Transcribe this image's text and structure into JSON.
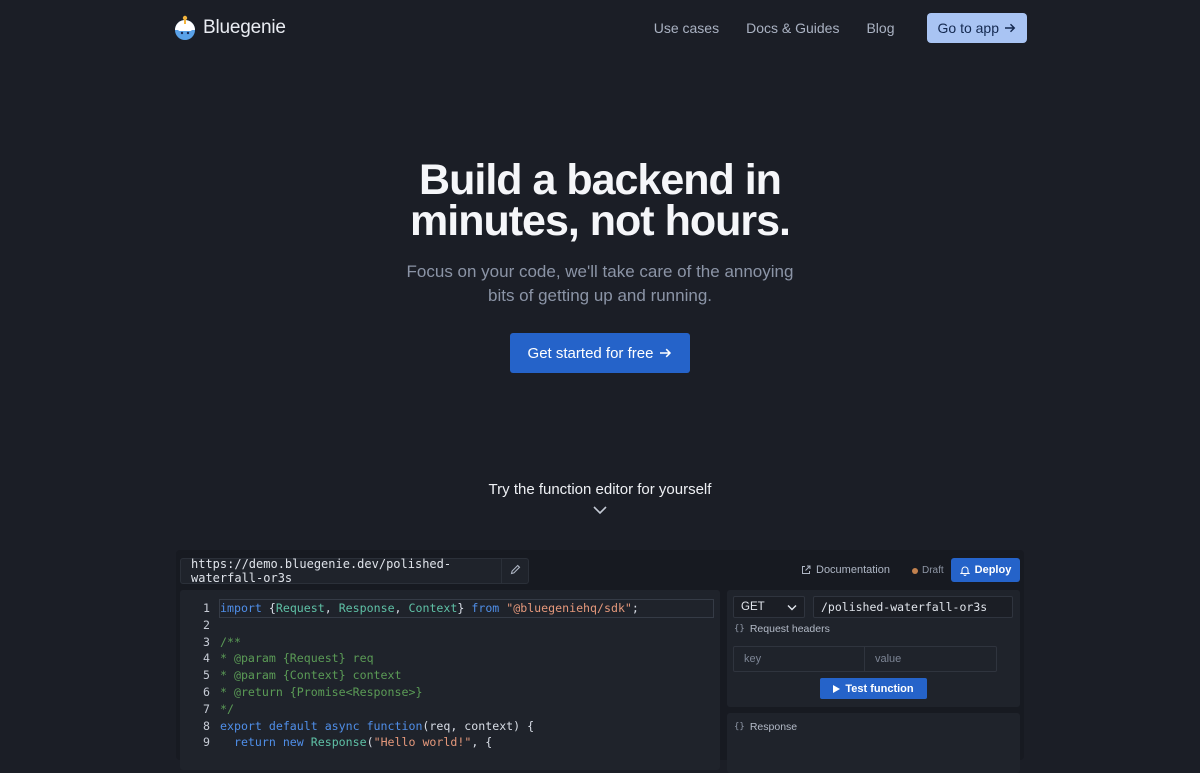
{
  "brand": {
    "name": "Bluegenie",
    "logo_icon": "genie-logo-icon"
  },
  "nav": {
    "links": [
      "Use cases",
      "Docs & Guides",
      "Blog"
    ],
    "app_button": "Go to app"
  },
  "hero": {
    "title_line1": "Build a backend in",
    "title_line2": "minutes, not hours.",
    "subtitle": "Focus on your code, we'll take care of the annoying bits of getting up and running.",
    "cta": "Get started for free"
  },
  "try_label": "Try the function editor for yourself",
  "editor": {
    "url": "https://demo.bluegenie.dev/polished-waterfall-or3s",
    "documentation_label": "Documentation",
    "status": "Draft",
    "deploy_label": "Deploy",
    "code_lines": [
      "import {Request, Response, Context} from \"@bluegeniehq/sdk\";",
      "",
      "/**",
      "* @param {Request} req",
      "* @param {Context} context",
      "* @return {Promise<Response>}",
      "*/",
      "export default async function(req, context) {",
      "  return new Response(\"Hello world!\", {"
    ],
    "request": {
      "method": "GET",
      "path": "/polished-waterfall-or3s",
      "headers_label": "Request headers",
      "key_placeholder": "key",
      "value_placeholder": "value",
      "test_label": "Test function"
    },
    "response_label": "Response"
  },
  "colors": {
    "background": "#1b1e26",
    "accent": "#2563c9",
    "app_button": "#a9c4f3",
    "draft_dot": "#c2814e"
  }
}
